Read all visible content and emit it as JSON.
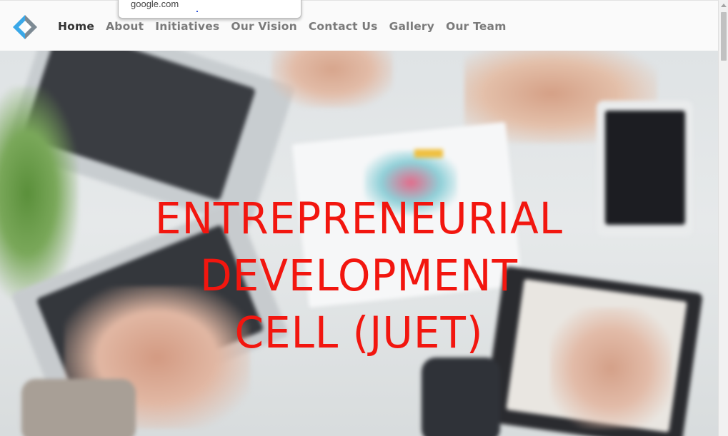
{
  "nav": {
    "items": [
      {
        "label": "Home",
        "active": true
      },
      {
        "label": "About",
        "active": false
      },
      {
        "label": "Initiatives",
        "active": false
      },
      {
        "label": "Our Vision",
        "active": false
      },
      {
        "label": "Contact Us",
        "active": false
      },
      {
        "label": "Gallery",
        "active": false
      },
      {
        "label": "Our Team",
        "active": false
      }
    ]
  },
  "popup": {
    "text": "google.com"
  },
  "hero": {
    "title_lines": [
      "ENTREPRENEURIAL",
      "DEVELOPMENT",
      "CELL (JUET)"
    ]
  },
  "colors": {
    "title": "#f2160f",
    "nav_active": "#333333",
    "nav_inactive": "#7a7a7a",
    "logo_blue": "#3aa8e8",
    "logo_gray": "#7d8a94"
  },
  "icons": {
    "logo": "edc-logo-icon"
  }
}
